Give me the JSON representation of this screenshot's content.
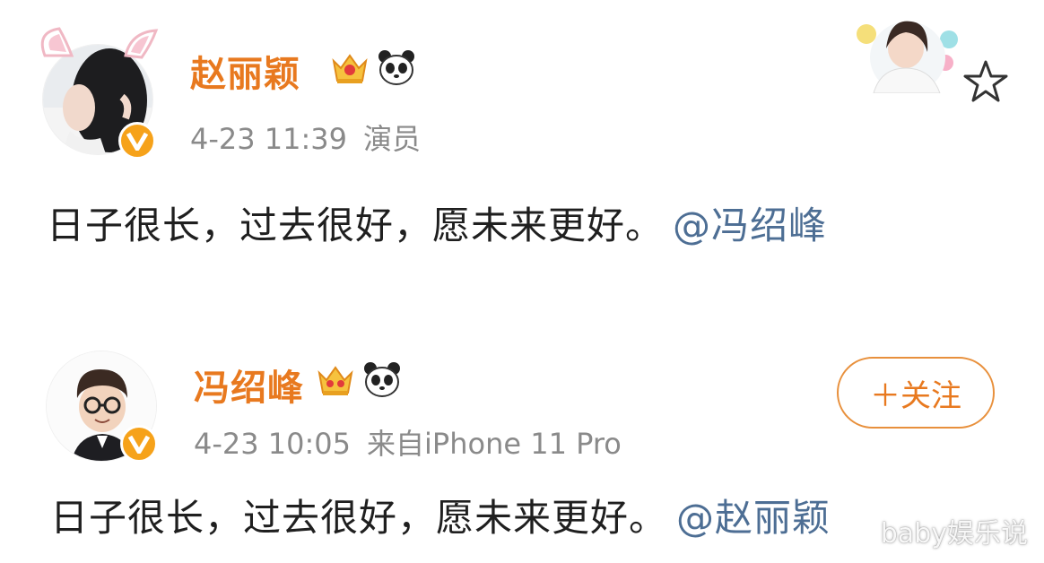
{
  "posts": [
    {
      "username": "赵丽颖",
      "timestamp": "4-23 11:39",
      "source": "演员",
      "content": "日子很长，过去很好，愿未来更好。",
      "mention": "@冯绍峰",
      "badges": [
        "crown-vip-icon",
        "panda-icon"
      ],
      "avatar_icon": "female-avatar-bunny-ears",
      "verified_icon": "verified-v-icon"
    },
    {
      "username": "冯绍峰",
      "timestamp": "4-23 10:05",
      "source": "来自iPhone 11 Pro",
      "content": "日子很长，过去很好，愿未来更好。",
      "mention": "@赵丽颖",
      "badges": [
        "crown-vip-icon",
        "panda-icon"
      ],
      "avatar_icon": "male-cartoon-avatar-glasses",
      "verified_icon": "verified-v-icon",
      "follow_label": "＋关注"
    }
  ],
  "watermark": "baby娱乐说",
  "colors": {
    "username": "#e8791f",
    "mention": "#4d6e94",
    "meta": "#8a8a8a",
    "verified": "#f6a21a",
    "follow_border": "#e8903c"
  }
}
